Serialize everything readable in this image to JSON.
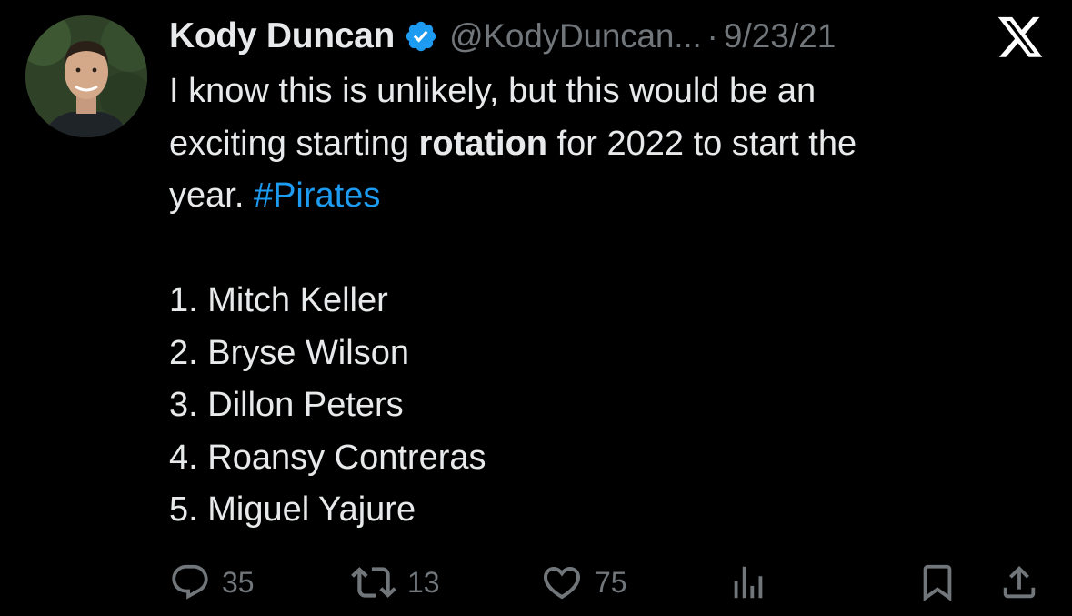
{
  "tweet": {
    "author_name": "Kody Duncan",
    "handle": "@KodyDuncan...",
    "separator": "·",
    "date": "9/23/21",
    "verified": true,
    "text_line1": "I know this is unlikely, but this would be an",
    "text_line2_pre": "exciting starting ",
    "text_line2_bold": "rotation",
    "text_line2_post": " for 2022 to start the",
    "text_line3_pre": "year. ",
    "hashtag": "#Pirates",
    "list": [
      "1.  Mitch Keller",
      "2. Bryse Wilson",
      "3. Dillon Peters",
      "4. Roansy Contreras",
      "5. Miguel Yajure"
    ]
  },
  "actions": {
    "replies": "35",
    "retweets": "13",
    "likes": "75"
  },
  "icons": {
    "verified": "verified-badge-icon",
    "brand": "x-logo-icon",
    "reply": "reply-icon",
    "retweet": "retweet-icon",
    "like": "heart-icon",
    "views": "analytics-icon",
    "bookmark": "bookmark-icon",
    "share": "share-icon"
  },
  "colors": {
    "background": "#000000",
    "text": "#e7e9ea",
    "secondary": "#71767b",
    "link": "#1d9bf0"
  }
}
